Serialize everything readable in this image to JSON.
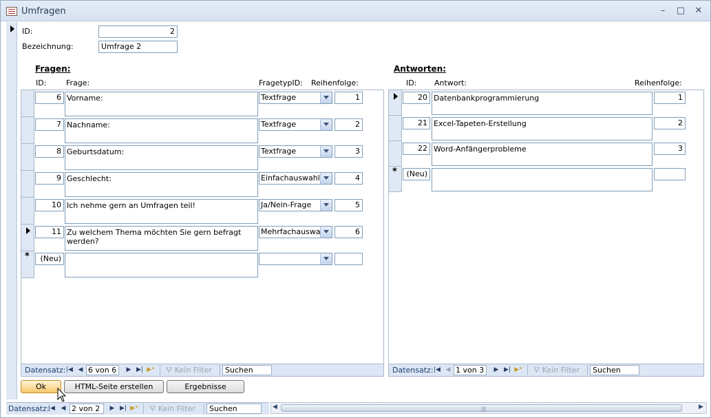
{
  "window": {
    "title": "Umfragen",
    "minimize": "–",
    "maximize": "□",
    "close": "✕"
  },
  "form": {
    "id_label": "ID:",
    "id_value": "2",
    "bezeichnung_label": "Bezeichnung:",
    "bezeichnung_value": "Umfrage 2"
  },
  "fragen": {
    "heading": "Fragen:",
    "headers": {
      "id": "ID:",
      "frage": "Frage:",
      "typ": "FragetypID:",
      "reihenfolge": "Reihenfolge:"
    },
    "rows": [
      {
        "id": "6",
        "frage": "Vorname:",
        "typ": "Textfrage",
        "reihenfolge": "1"
      },
      {
        "id": "7",
        "frage": "Nachname:",
        "typ": "Textfrage",
        "reihenfolge": "2"
      },
      {
        "id": "8",
        "frage": "Geburtsdatum:",
        "typ": "Textfrage",
        "reihenfolge": "3"
      },
      {
        "id": "9",
        "frage": "Geschlecht:",
        "typ": "Einfachauswahl",
        "reihenfolge": "4"
      },
      {
        "id": "10",
        "frage": "Ich nehme gern an Umfragen teil!",
        "typ": "Ja/Nein-Frage",
        "reihenfolge": "5"
      },
      {
        "id": "11",
        "frage": "Zu welchem Thema möchten Sie gern befragt werden?",
        "typ": "Mehrfachauswa",
        "reihenfolge": "6"
      }
    ],
    "new_row": {
      "id": "(Neu)"
    },
    "nav": {
      "label": "Datensatz:",
      "position": "6 von 6",
      "filter": "Kein Filter",
      "search": "Suchen"
    }
  },
  "antworten": {
    "heading": "Antworten:",
    "headers": {
      "id": "ID:",
      "antwort": "Antwort:",
      "reihenfolge": "Reihenfolge:"
    },
    "rows": [
      {
        "id": "20",
        "antwort": "Datenbankprogrammierung",
        "reihenfolge": "1"
      },
      {
        "id": "21",
        "antwort": "Excel-Tapeten-Erstellung",
        "reihenfolge": "2"
      },
      {
        "id": "22",
        "antwort": "Word-Anfängerprobleme",
        "reihenfolge": "3"
      }
    ],
    "new_row": {
      "id": "(Neu)"
    },
    "nav": {
      "label": "Datensatz:",
      "position": "1 von 3",
      "filter": "Kein Filter",
      "search": "Suchen"
    }
  },
  "buttons": {
    "ok": "Ok",
    "html": "HTML-Seite erstellen",
    "ergebnisse": "Ergebnisse"
  },
  "main_nav": {
    "label": "Datensatz:",
    "position": "2 von 2",
    "filter": "Kein Filter",
    "search": "Suchen"
  }
}
